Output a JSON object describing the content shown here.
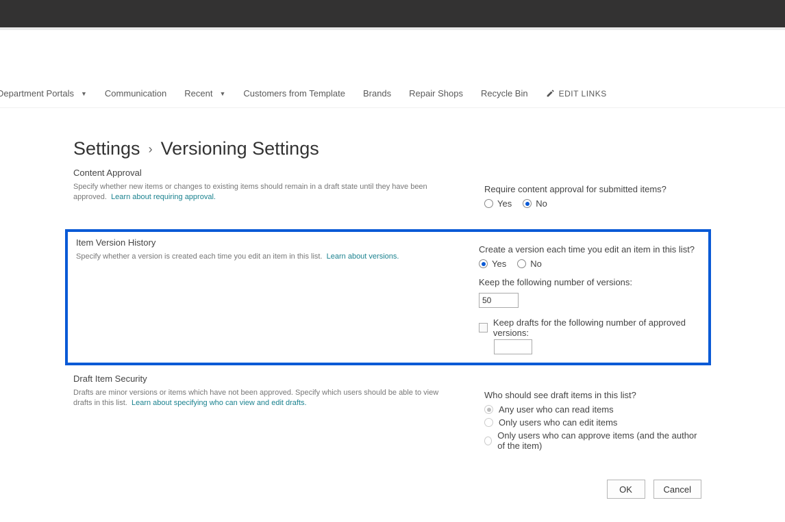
{
  "nav": {
    "items": [
      {
        "label": "Department Portals",
        "has_dropdown": true
      },
      {
        "label": "Communication",
        "has_dropdown": false
      },
      {
        "label": "Recent",
        "has_dropdown": true
      },
      {
        "label": "Customers from Template",
        "has_dropdown": false
      },
      {
        "label": "Brands",
        "has_dropdown": false
      },
      {
        "label": "Repair Shops",
        "has_dropdown": false
      },
      {
        "label": "Recycle Bin",
        "has_dropdown": false
      }
    ],
    "edit_links_label": "EDIT LINKS"
  },
  "breadcrumb": {
    "parent": "Settings",
    "separator": "›",
    "current": "Versioning Settings"
  },
  "content_approval": {
    "title": "Content Approval",
    "desc": "Specify whether new items or changes to existing items should remain in a draft state until they have been approved.",
    "link": "Learn about requiring approval.",
    "question": "Require content approval for submitted items?",
    "opt_yes": "Yes",
    "opt_no": "No",
    "selected": "No"
  },
  "version_history": {
    "title": "Item Version History",
    "desc": "Specify whether a version is created each time you edit an item in this list.",
    "link": "Learn about versions.",
    "question": "Create a version each time you edit an item in this list?",
    "opt_yes": "Yes",
    "opt_no": "No",
    "selected": "Yes",
    "keep_versions_label": "Keep the following number of versions:",
    "keep_versions_value": "50",
    "keep_drafts_label": "Keep drafts for the following number of approved versions:",
    "keep_drafts_value": ""
  },
  "draft_security": {
    "title": "Draft Item Security",
    "desc": "Drafts are minor versions or items which have not been approved. Specify which users should be able to view drafts in this list.",
    "link": "Learn about specifying who can view and edit drafts.",
    "question": "Who should see draft items in this list?",
    "opt1": "Any user who can read items",
    "opt2": "Only users who can edit items",
    "opt3": "Only users who can approve items (and the author of the item)",
    "selected": "opt1"
  },
  "buttons": {
    "ok": "OK",
    "cancel": "Cancel"
  }
}
